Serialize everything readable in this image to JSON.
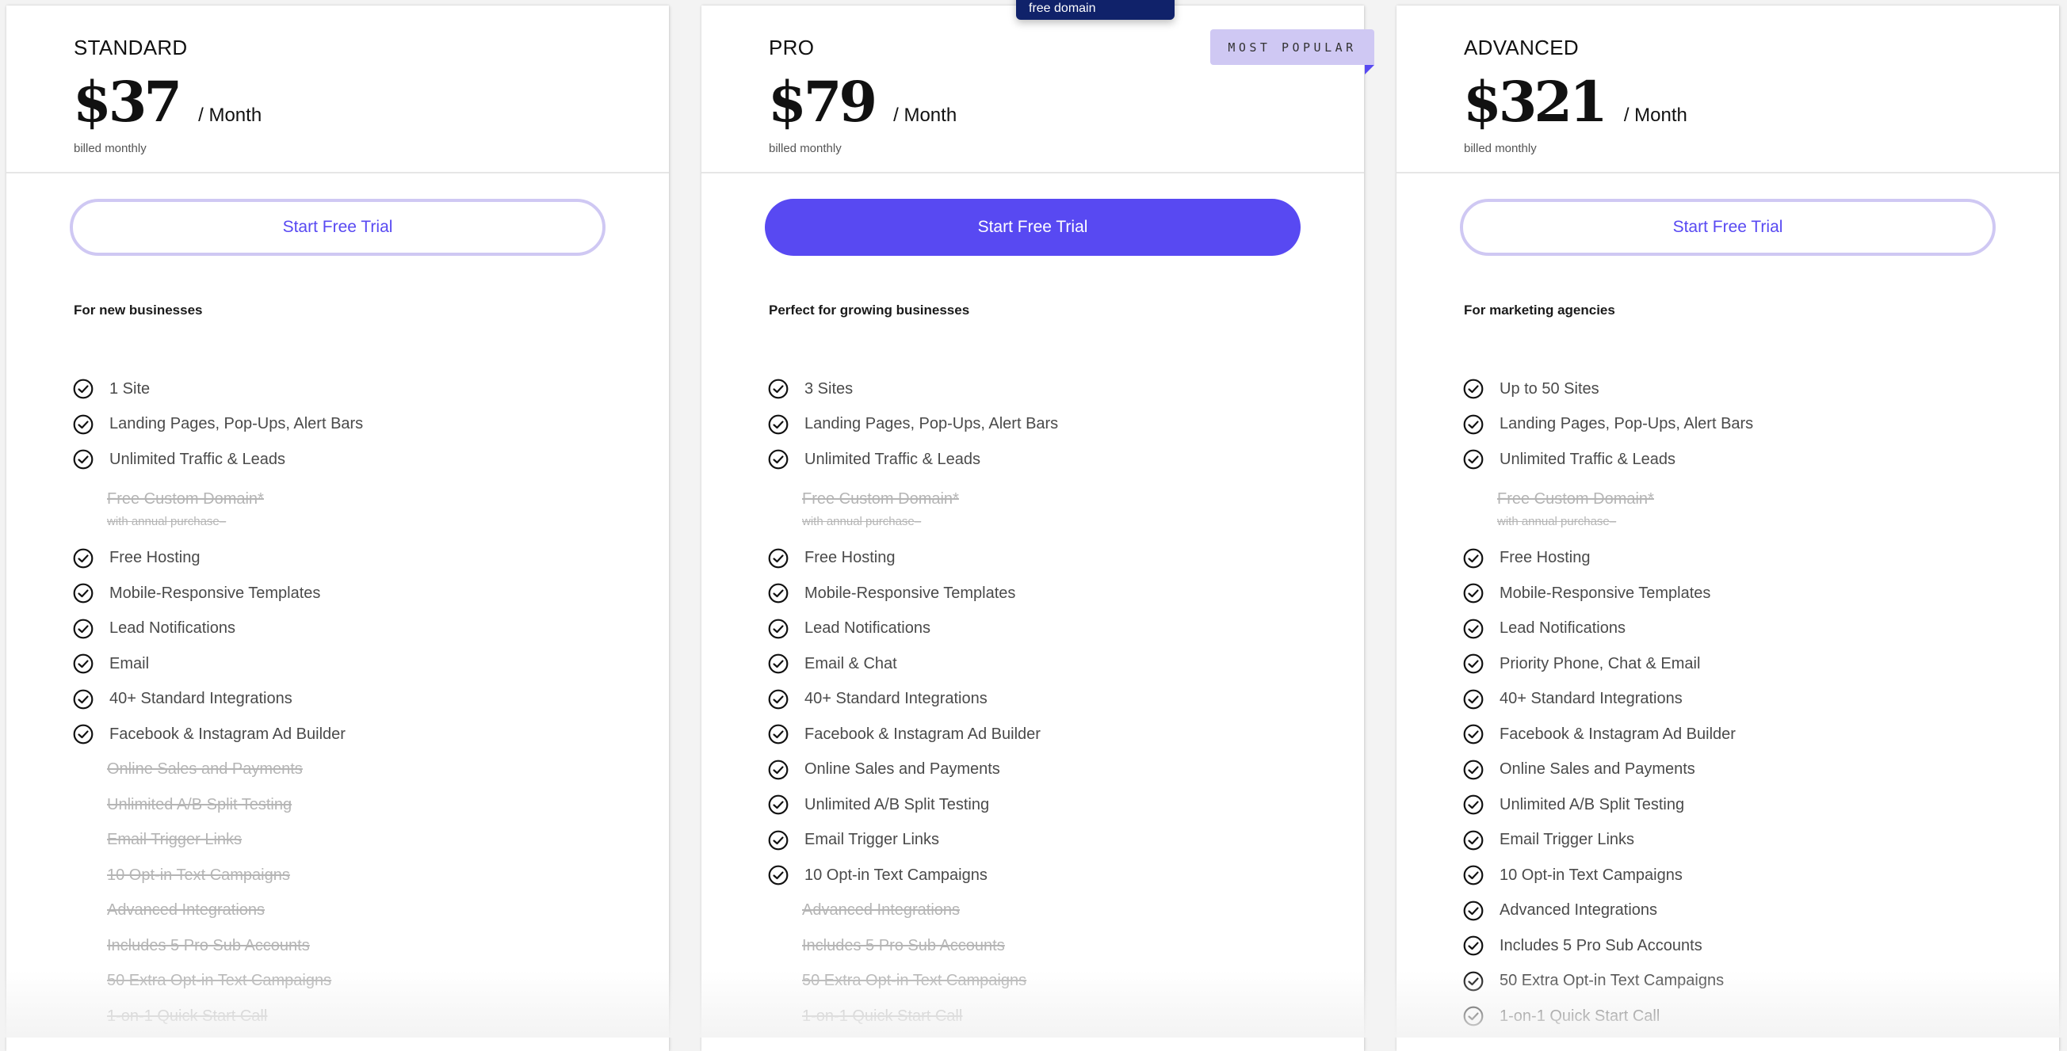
{
  "tooltip": {
    "text": "free domain"
  },
  "plans": [
    {
      "name": "STANDARD",
      "price": "$37",
      "period": "/ Month",
      "billing": "billed monthly",
      "cta": "Start Free Trial",
      "cta_style": "outline",
      "tagline": "For new businesses",
      "badge": null,
      "features": [
        {
          "label": "1 Site",
          "included": true
        },
        {
          "label": "Landing Pages, Pop-Ups, Alert Bars",
          "included": true
        },
        {
          "label": "Unlimited Traffic & Leads",
          "included": true
        },
        {
          "label": "Free Custom Domain*",
          "sub": "with annual purchase–",
          "included": false
        },
        {
          "label": "Free Hosting",
          "included": true
        },
        {
          "label": "Mobile-Responsive Templates",
          "included": true
        },
        {
          "label": "Lead Notifications",
          "included": true
        },
        {
          "label": "Email",
          "included": true
        },
        {
          "label": "40+ Standard Integrations",
          "included": true
        },
        {
          "label": "Facebook & Instagram Ad Builder",
          "included": true
        },
        {
          "label": "Online Sales and Payments",
          "included": false
        },
        {
          "label": "Unlimited A/B Split Testing",
          "included": false
        },
        {
          "label": "Email Trigger Links",
          "included": false
        },
        {
          "label": "10 Opt-in Text Campaigns",
          "included": false
        },
        {
          "label": "Advanced Integrations",
          "included": false
        },
        {
          "label": "Includes 5 Pro Sub Accounts",
          "included": false
        },
        {
          "label": "50 Extra Opt-in Text Campaigns",
          "included": false
        },
        {
          "label": "1-on-1 Quick Start Call",
          "included": false
        }
      ]
    },
    {
      "name": "PRO",
      "price": "$79",
      "period": "/ Month",
      "billing": "billed monthly",
      "cta": "Start Free Trial",
      "cta_style": "filled",
      "tagline": "Perfect for growing businesses",
      "badge": "MOST POPULAR",
      "features": [
        {
          "label": "3 Sites",
          "included": true
        },
        {
          "label": "Landing Pages, Pop-Ups, Alert Bars",
          "included": true
        },
        {
          "label": "Unlimited Traffic & Leads",
          "included": true
        },
        {
          "label": "Free Custom Domain*",
          "sub": "with annual purchase–",
          "included": false
        },
        {
          "label": "Free Hosting",
          "included": true
        },
        {
          "label": "Mobile-Responsive Templates",
          "included": true
        },
        {
          "label": "Lead Notifications",
          "included": true
        },
        {
          "label": "Email & Chat",
          "included": true
        },
        {
          "label": "40+ Standard Integrations",
          "included": true
        },
        {
          "label": "Facebook & Instagram Ad Builder",
          "included": true
        },
        {
          "label": "Online Sales and Payments",
          "included": true
        },
        {
          "label": "Unlimited A/B Split Testing",
          "included": true
        },
        {
          "label": "Email Trigger Links",
          "included": true
        },
        {
          "label": "10 Opt-in Text Campaigns",
          "included": true
        },
        {
          "label": "Advanced Integrations",
          "included": false
        },
        {
          "label": "Includes 5 Pro Sub Accounts",
          "included": false
        },
        {
          "label": "50 Extra Opt-in Text Campaigns",
          "included": false
        },
        {
          "label": "1-on-1 Quick Start Call",
          "included": false
        }
      ]
    },
    {
      "name": "ADVANCED",
      "price": "$321",
      "period": "/ Month",
      "billing": "billed monthly",
      "cta": "Start Free Trial",
      "cta_style": "outline",
      "tagline": "For marketing agencies",
      "badge": null,
      "features": [
        {
          "label": "Up to 50 Sites",
          "included": true
        },
        {
          "label": "Landing Pages, Pop-Ups, Alert Bars",
          "included": true
        },
        {
          "label": "Unlimited Traffic & Leads",
          "included": true
        },
        {
          "label": "Free Custom Domain*",
          "sub": "with annual purchase–",
          "included": false
        },
        {
          "label": "Free Hosting",
          "included": true
        },
        {
          "label": "Mobile-Responsive Templates",
          "included": true
        },
        {
          "label": "Lead Notifications",
          "included": true
        },
        {
          "label": "Priority Phone, Chat & Email",
          "included": true
        },
        {
          "label": "40+ Standard Integrations",
          "included": true
        },
        {
          "label": "Facebook & Instagram Ad Builder",
          "included": true
        },
        {
          "label": "Online Sales and Payments",
          "included": true
        },
        {
          "label": "Unlimited A/B Split Testing",
          "included": true
        },
        {
          "label": "Email Trigger Links",
          "included": true
        },
        {
          "label": "10 Opt-in Text Campaigns",
          "included": true
        },
        {
          "label": "Advanced Integrations",
          "included": true
        },
        {
          "label": "Includes 5 Pro Sub Accounts",
          "included": true
        },
        {
          "label": "50 Extra Opt-in Text Campaigns",
          "included": true
        },
        {
          "label": "1-on-1 Quick Start Call",
          "included": true
        }
      ]
    }
  ],
  "colors": {
    "accent": "#5849f2",
    "accent_light": "#cfc8f3",
    "tooltip_bg": "#10226a",
    "disabled_text": "#b5b5b5"
  }
}
